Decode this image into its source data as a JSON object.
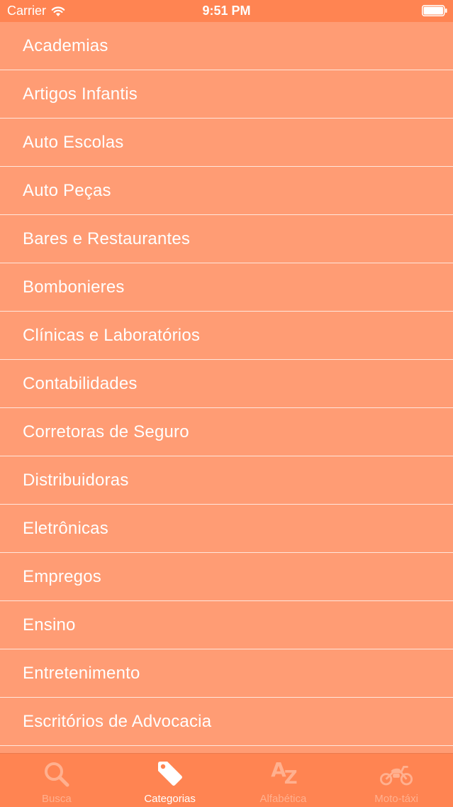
{
  "status_bar": {
    "carrier": "Carrier",
    "time": "9:51 PM"
  },
  "categories": [
    "Academias",
    "Artigos Infantis",
    "Auto Escolas",
    "Auto Peças",
    "Bares e Restaurantes",
    "Bombonieres",
    "Clínicas e Laboratórios",
    "Contabilidades",
    "Corretoras de Seguro",
    "Distribuidoras",
    "Eletrônicas",
    "Empregos",
    "Ensino",
    "Entretenimento",
    "Escritórios de Advocacia"
  ],
  "tabs": [
    {
      "label": "Busca",
      "icon": "search-icon",
      "active": false
    },
    {
      "label": "Categorias",
      "icon": "tag-icon",
      "active": true
    },
    {
      "label": "Alfabética",
      "icon": "az-icon",
      "active": false,
      "glyph_a": "A",
      "glyph_z": "Z"
    },
    {
      "label": "Moto-táxi",
      "icon": "motorcycle-icon",
      "active": false
    }
  ],
  "colors": {
    "bar": "#ff8452",
    "list_bg": "#ff9c74",
    "text": "#ffffff",
    "inactive_tab": "#ffb08f"
  }
}
